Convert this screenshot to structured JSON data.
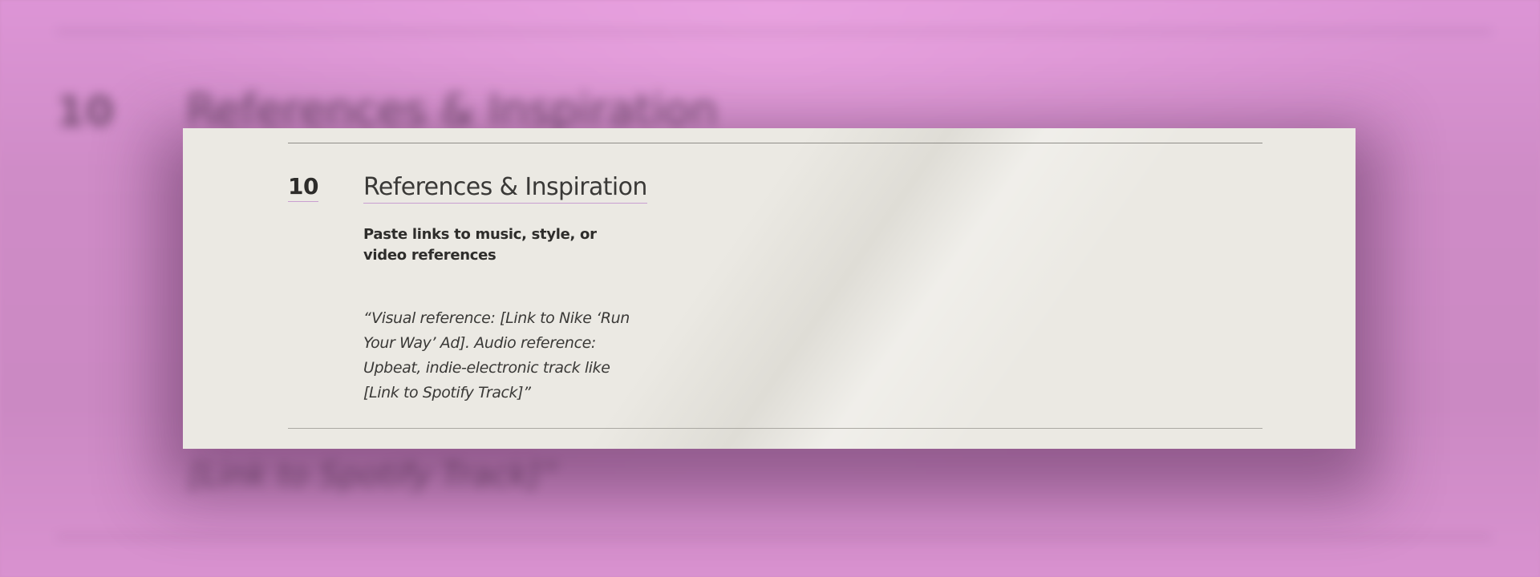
{
  "section": {
    "number": "10",
    "title": "References & Inspiration",
    "prompt": "Paste links to music, style, or video references",
    "answer": "“Visual reference: [Link to Nike ‘Run Your Way’ Ad]. Audio reference: Upbeat, indie-electronic track like [Link to Spotify Track]”"
  },
  "colors": {
    "backdrop": "#d48fc8",
    "card": "#ebe9e3",
    "underline_accent": "#c99fd0"
  }
}
